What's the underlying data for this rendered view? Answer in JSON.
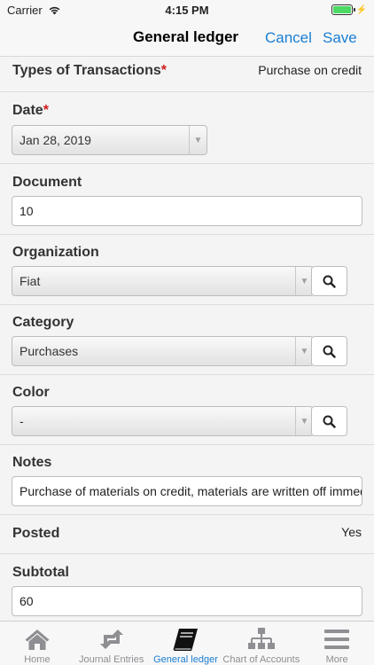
{
  "status": {
    "carrier": "Carrier",
    "time": "4:15 PM",
    "battery_level": 1.0
  },
  "nav": {
    "title": "General ledger",
    "cancel_label": "Cancel",
    "save_label": "Save"
  },
  "form": {
    "transaction_type": {
      "label": "Types of Transactions",
      "required_mark": "*",
      "value": "Purchase on credit"
    },
    "date": {
      "label": "Date",
      "required_mark": "*",
      "value": "Jan 28, 2019"
    },
    "document": {
      "label": "Document",
      "value": "10"
    },
    "organization": {
      "label": "Organization",
      "value": "Fiat"
    },
    "category": {
      "label": "Category",
      "value": "Purchases"
    },
    "color": {
      "label": "Color",
      "value": "-"
    },
    "notes": {
      "label": "Notes",
      "value": "Purchase of materials on credit, materials are written off immediately"
    },
    "posted": {
      "label": "Posted",
      "value": "Yes"
    },
    "subtotal": {
      "label": "Subtotal",
      "value": "60"
    }
  },
  "tabs": [
    {
      "label": "Home",
      "icon": "home-icon"
    },
    {
      "label": "Journal Entries",
      "icon": "repeat-icon"
    },
    {
      "label": "General ledger",
      "icon": "book-icon",
      "active": true
    },
    {
      "label": "Chart of Accounts",
      "icon": "hierarchy-icon"
    },
    {
      "label": "More",
      "icon": "menu-icon"
    }
  ],
  "colors": {
    "accent": "#1a7ed3",
    "required": "#d21a1a",
    "battery": "#4cd964"
  }
}
